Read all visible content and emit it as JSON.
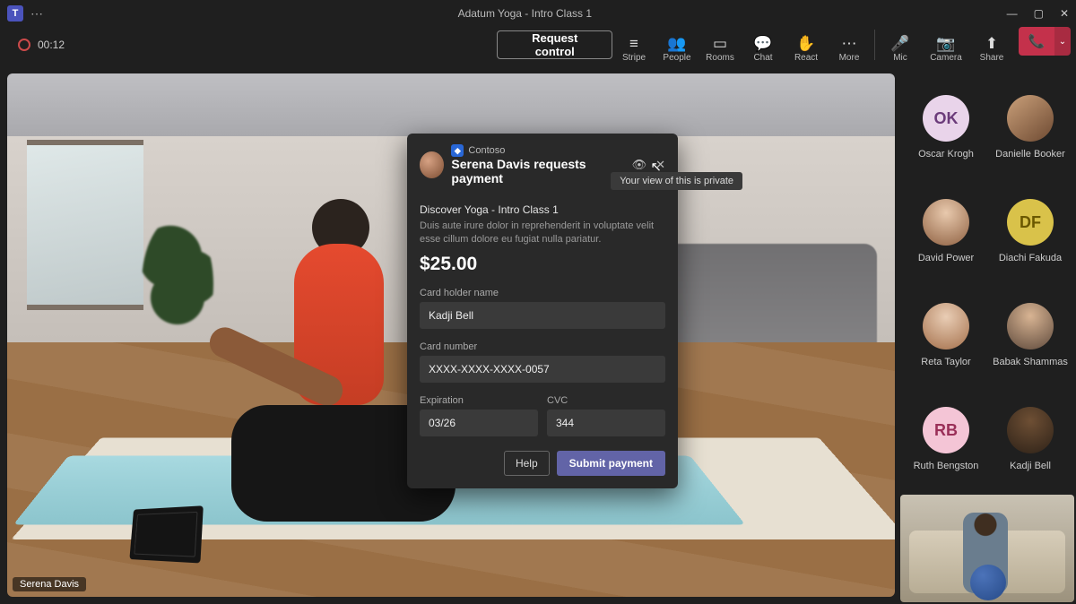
{
  "titlebar": {
    "title": "Adatum Yoga - Intro Class 1"
  },
  "recording": {
    "elapsed": "00:12"
  },
  "toolbar": {
    "request_control": "Request control",
    "stripe": "Stripe",
    "people": "People",
    "rooms": "Rooms",
    "chat": "Chat",
    "react": "React",
    "more": "More",
    "mic": "Mic",
    "camera": "Camera",
    "share": "Share"
  },
  "presenter": {
    "name": "Serena Davis"
  },
  "modal": {
    "vendor": "Contoso",
    "title": "Serena Davis requests payment",
    "tooltip": "Your view of this is private",
    "subtitle": "Discover Yoga - Intro Class 1",
    "description": "Duis aute irure dolor in reprehenderit in voluptate velit esse cillum dolore eu fugiat nulla pariatur.",
    "price": "$25.00",
    "cardholder_label": "Card holder name",
    "cardholder_value": "Kadji Bell",
    "cardnumber_label": "Card number",
    "cardnumber_value": "XXXX-XXXX-XXXX-0057",
    "expiration_label": "Expiration",
    "expiration_value": "03/26",
    "cvc_label": "CVC",
    "cvc_value": "344",
    "help": "Help",
    "submit": "Submit payment"
  },
  "participants": [
    {
      "name": "Oscar Krogh",
      "initials": "OK",
      "bg": "#e9d4ea",
      "fg": "#6b3b7a",
      "type": "initials"
    },
    {
      "name": "Danielle Booker",
      "type": "photo",
      "bg": "linear-gradient(140deg,#caa07a,#6e4a32)"
    },
    {
      "name": "David Power",
      "type": "photo",
      "bg": "radial-gradient(circle at 50% 30%,#e8c9ad,#8f6142)"
    },
    {
      "name": "Diachi Fakuda",
      "initials": "DF",
      "bg": "#d9c24a",
      "fg": "#6b5800",
      "type": "initials"
    },
    {
      "name": "Reta Taylor",
      "type": "photo",
      "bg": "radial-gradient(circle at 50% 30%,#e9cdb5,#a4704b)"
    },
    {
      "name": "Babak Shammas",
      "type": "photo",
      "bg": "radial-gradient(circle at 50% 28%,#d8b493,#5f4a3c)"
    },
    {
      "name": "Ruth Bengston",
      "initials": "RB",
      "bg": "#f4c5d6",
      "fg": "#9a2f58",
      "type": "initials"
    },
    {
      "name": "Kadji Bell",
      "type": "photo",
      "bg": "radial-gradient(circle at 50% 30%,#6e4f34,#2e2218)"
    }
  ]
}
